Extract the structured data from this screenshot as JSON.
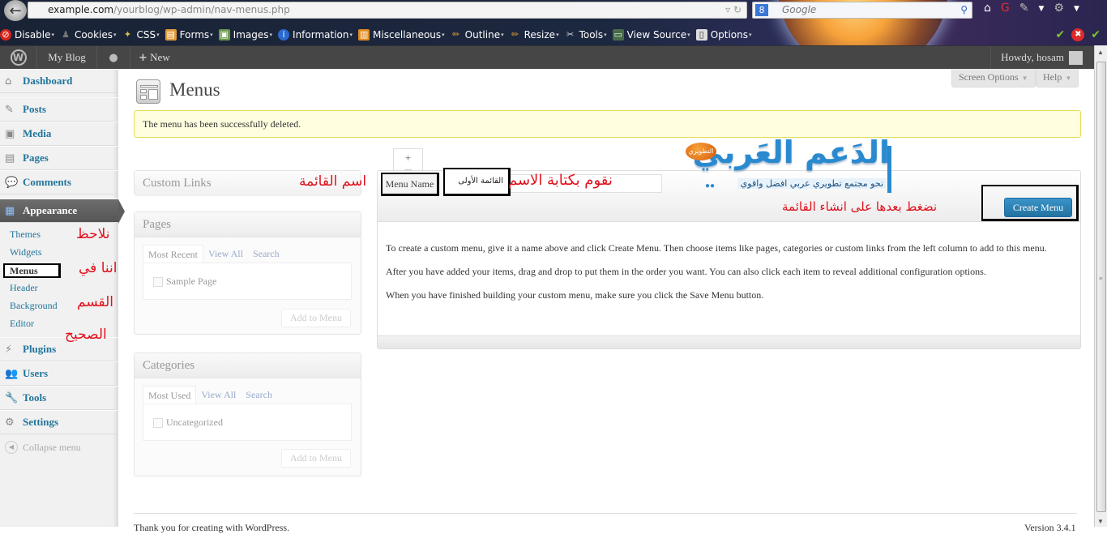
{
  "browser": {
    "back_icon": "back-arrow-icon",
    "url_domain": "example.com",
    "url_path": "/yourblog/wp-admin/nav-menus.php",
    "search_engine_icon": "google-icon",
    "search_placeholder": "Google",
    "toolbar_icons": [
      "home-icon",
      "addon-icon",
      "pen-icon",
      "dropdown-icon",
      "gear-icon",
      "dropdown-icon"
    ],
    "devbar": [
      {
        "label": "Disable",
        "icon": "disable-icon",
        "color": "#d9251c"
      },
      {
        "label": "Cookies",
        "icon": "cookie-icon",
        "color": "#555555"
      },
      {
        "label": "CSS",
        "icon": "css-icon",
        "color": "#b8a030"
      },
      {
        "label": "Forms",
        "icon": "forms-icon",
        "color": "#e09a3a"
      },
      {
        "label": "Images",
        "icon": "images-icon",
        "color": "#6a9a4a"
      },
      {
        "label": "Information",
        "icon": "info-icon",
        "color": "#2a6ad0"
      },
      {
        "label": "Miscellaneous",
        "icon": "misc-icon",
        "color": "#e08a20"
      },
      {
        "label": "Outline",
        "icon": "pencil-icon",
        "color": "#e0a030"
      },
      {
        "label": "Resize",
        "icon": "ruler-icon",
        "color": "#e0a030"
      },
      {
        "label": "Tools",
        "icon": "tools-icon",
        "color": "#cccccc"
      },
      {
        "label": "View Source",
        "icon": "source-icon",
        "color": "#4a6a4a"
      },
      {
        "label": "Options",
        "icon": "options-icon",
        "color": "#dddddd"
      }
    ],
    "status_icons": [
      "check-icon",
      "error-icon",
      "check-icon"
    ]
  },
  "adminbar": {
    "site_name": "My Blog",
    "new_label": "New",
    "greeting": "Howdy, hosam"
  },
  "sidebar": {
    "items": [
      {
        "label": "Dashboard",
        "icon": "⌂"
      },
      {
        "label": "Posts",
        "icon": "✎"
      },
      {
        "label": "Media",
        "icon": "▣"
      },
      {
        "label": "Pages",
        "icon": "▤"
      },
      {
        "label": "Comments",
        "icon": "💬"
      },
      {
        "label": "Appearance",
        "icon": "▦"
      },
      {
        "label": "Plugins",
        "icon": "⚡"
      },
      {
        "label": "Users",
        "icon": "👥"
      },
      {
        "label": "Tools",
        "icon": "🔧"
      },
      {
        "label": "Settings",
        "icon": "⚙"
      }
    ],
    "appearance_sub": [
      "Themes",
      "Widgets",
      "Menus",
      "Header",
      "Background",
      "Editor"
    ],
    "collapse_label": "Collapse menu"
  },
  "annotations": {
    "sidebar": [
      "نلاحظ",
      "اننا في",
      "القسم",
      "الصحيح"
    ],
    "menu_name": "اسم القائمة",
    "type_name": "نقوم بكتابة الاسم",
    "click_create": "نضغط بعدها على انشاء القائمة"
  },
  "header": {
    "title": "Menus",
    "screen_options": "Screen Options",
    "help": "Help"
  },
  "notice": "The menu has been successfully deleted.",
  "boxes": {
    "custom_links": {
      "title": "Custom Links"
    },
    "pages": {
      "title": "Pages",
      "tabs": [
        "Most Recent",
        "View All",
        "Search"
      ],
      "items": [
        "Sample Page"
      ],
      "button": "Add to Menu"
    },
    "categories": {
      "title": "Categories",
      "tabs": [
        "Most Used",
        "View All",
        "Search"
      ],
      "items": [
        "Uncategorized"
      ],
      "button": "Add to Menu"
    }
  },
  "editor": {
    "add_tab": "+",
    "menu_name_label": "Menu Name",
    "menu_name_value": "القائمة الأولى",
    "create_button": "Create Menu",
    "instructions": [
      "To create a custom menu, give it a name above and click Create Menu. Then choose items like pages, categories or custom links from the left column to add to this menu.",
      "After you have added your items, drag and drop to put them in the order you want. You can also click each item to reveal additional configuration options.",
      "When you have finished building your custom menu, make sure you click the Save Menu button."
    ]
  },
  "logo": {
    "badge": "التطويري",
    "main": "الدَعم العَربي",
    "tagline": "نحو مجتمع تطويري عربي افضل واقوي"
  },
  "footer": {
    "left": "Thank you for creating with WordPress.",
    "right": "Version 3.4.1"
  }
}
